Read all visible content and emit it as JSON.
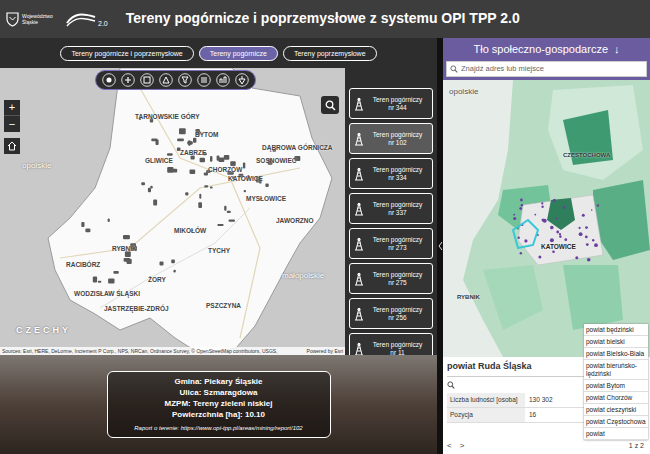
{
  "header": {
    "logo_text": "Województwo Śląskie",
    "version": "2.0",
    "title": "Tereny pogórnicze i poprzemysłowe z systemu OPI TPP 2.0"
  },
  "tabs": [
    {
      "label": "Tereny pogórnicze i poprzemysłowe",
      "selected": false
    },
    {
      "label": "Tereny pogórnicze",
      "selected": true
    },
    {
      "label": "Tereny poprzemysłowe",
      "selected": false
    }
  ],
  "map": {
    "zoom_in": "+",
    "zoom_out": "−",
    "labels": [
      "TARNOWSKIE GÓRY",
      "BYTOM",
      "DĄBROWA GÓRNICZA",
      "GLIWICE",
      "ZABRZE",
      "CHORZÓW",
      "SOSNOWIEC",
      "KATOWICE",
      "MYSŁOWICE",
      "JAWORZNO",
      "MIKOŁÓW",
      "TYCHY",
      "RACIBÓRZ",
      "RYBNIK",
      "ŻORY",
      "WODZISŁAW ŚLĄSKI",
      "JASTRZĘBIE-ZDRÓJ",
      "PSZCZYNA",
      "opolskie",
      "małopolskie",
      "CZECHY"
    ],
    "attribution": "Sources: Esri, HERE, DeLorme, Increment P Corp., NPS, NRCan, Ordnance Survey, © OpenStreetMap contributors, USGS,",
    "powered": "Powered by Esri"
  },
  "sites": [
    {
      "name": "Teren pogórniczy",
      "number": "nr 344",
      "selected": false
    },
    {
      "name": "Teren pogórniczy",
      "number": "nr 102",
      "selected": true
    },
    {
      "name": "Teren pogórniczy",
      "number": "nr 334",
      "selected": false
    },
    {
      "name": "Teren pogórniczy",
      "number": "nr 337",
      "selected": false
    },
    {
      "name": "Teren pogórniczy",
      "number": "nr 273",
      "selected": false
    },
    {
      "name": "Teren pogórniczy",
      "number": "nr 275",
      "selected": false
    },
    {
      "name": "Teren pogórniczy",
      "number": "nr 256",
      "selected": false
    },
    {
      "name": "Teren pogórniczy",
      "number": "nr 11",
      "selected": false
    }
  ],
  "details": {
    "lines": [
      "Gmina: Piekary Śląskie",
      "Ulica: Szmaragdowa",
      "MZPM: Tereny zieleni niskiej",
      "Powierzchnia [ha]: 10.10"
    ],
    "report": "Raport o terenie: https://www.opi-tpp.pl/areas/mining/report/102"
  },
  "side": {
    "title": "Tło społeczno-gospodarcze",
    "arrow": "↓",
    "search_placeholder": "Znajdź adres lub miejsce",
    "labels": [
      "opolskie",
      "CZĘSTOCHOWA",
      "KATOWICE",
      "RYBNIK"
    ],
    "legend": [
      "powiat będziński",
      "powiat bielski",
      "powiat Bielsko-Biała",
      "powiat bieruńsko-lędziński",
      "powiat Bytom",
      "powiat Chorzów",
      "powiat cieszyński",
      "powiat Częstochowa",
      "powiat"
    ],
    "table": {
      "title": "powiat Ruda Śląska",
      "rows": [
        [
          "Liczba ludności [osoba]",
          "130 302"
        ],
        [
          "Pozycja",
          "16"
        ]
      ],
      "prev": "<",
      "next": ">",
      "page": "1 z 2"
    }
  }
}
